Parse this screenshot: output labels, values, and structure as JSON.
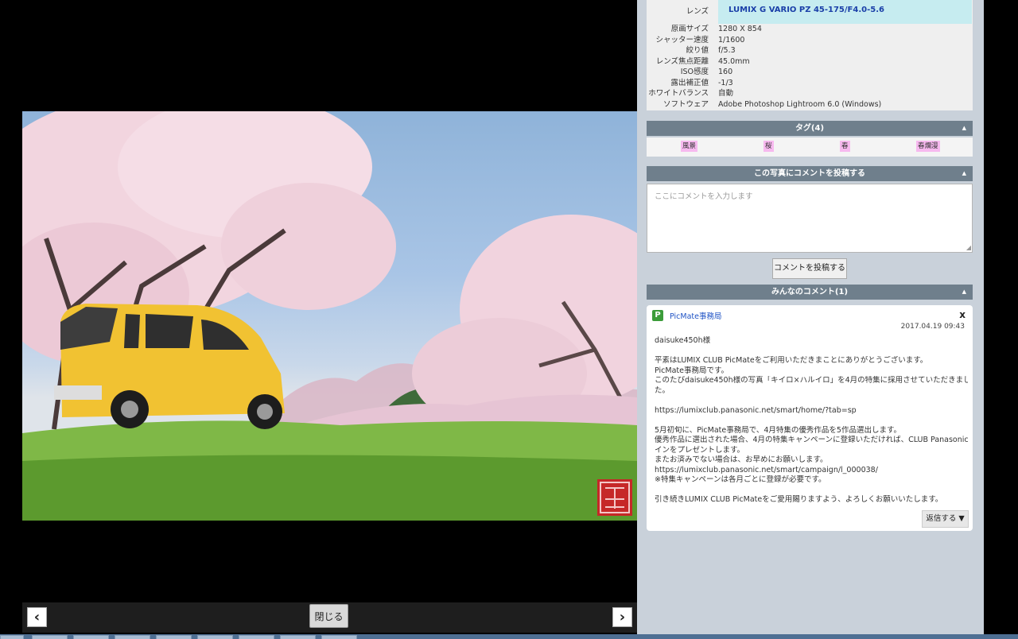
{
  "viewer": {
    "prev_icon": "chevron-left-icon",
    "next_icon": "chevron-right-icon",
    "prev_glyph": "‹",
    "next_glyph": "›",
    "close_label": "閉じる",
    "photo_stamp_icon": "red-seal-stamp"
  },
  "exif": {
    "lens": {
      "key": "レンズ",
      "value": "LUMIX G VARIO PZ 45-175/F4.0-5.6"
    },
    "rows": [
      {
        "key": "原画サイズ",
        "value": "1280 X 854"
      },
      {
        "key": "シャッター速度",
        "value": "1/1600"
      },
      {
        "key": "絞り値",
        "value": "f/5.3"
      },
      {
        "key": "レンズ焦点距離",
        "value": "45.0mm"
      },
      {
        "key": "ISO感度",
        "value": "160"
      },
      {
        "key": "露出補正値",
        "value": "-1/3"
      },
      {
        "key": "ホワイトバランス",
        "value": "自動"
      },
      {
        "key": "ソフトウェア",
        "value": "Adobe Photoshop Lightroom 6.0 (Windows)"
      }
    ]
  },
  "tags": {
    "header": "タグ(4)",
    "collapse_icon": "triangle-up-icon",
    "items": [
      "風景",
      "桜",
      "春",
      "春爛漫"
    ]
  },
  "post_comment": {
    "header": "この写真にコメントを投稿する",
    "placeholder": "ここにコメントを入力します",
    "button_label": "コメントを投稿する"
  },
  "comments": {
    "header": "みんなのコメント(1)",
    "items": [
      {
        "author": "PicMate事務局",
        "avatar_icon": "picmate-logo-icon",
        "delete_label": "x",
        "date": "2017.04.19 09:43",
        "lines": [
          "daisuke450h様",
          "",
          "平素はLUMIX CLUB PicMateをご利用いただきまことにありがとうございます。",
          "PicMate事務局です。",
          "このたびdaisuke450h様の写真「キイロ×ハルイロ」を4月の特集に採用させていただきまし",
          "た。",
          "",
          "https://lumixclub.panasonic.net/smart/home/?tab=sp",
          "",
          "5月初旬に、PicMate事務局で、4月特集の優秀作品を5作品選出します。",
          "優秀作品に選出された場合、4月の特集キャンペーンに登録いただければ、CLUB Panasonicコ",
          "インをプレゼントします。",
          "またお済みでない場合は、お早めにお願いします。",
          "https://lumixclub.panasonic.net/smart/campaign/l_000038/",
          "※特集キャンペーンは各月ごとに登録が必要です。",
          "",
          "引き続きLUMIX CLUB PicMateをご愛用賜りますよう、よろしくお願いいたします。"
        ],
        "reply_label": "返信する ▼"
      }
    ]
  }
}
